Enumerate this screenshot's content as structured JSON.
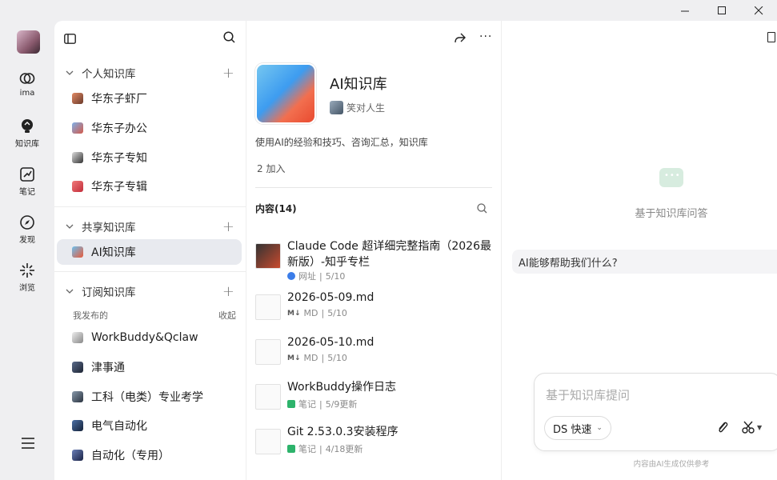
{
  "window": {
    "minimize": "—",
    "maximize": "☐",
    "close": "✕"
  },
  "rail": {
    "items": [
      {
        "label": "ima"
      },
      {
        "label": "知识库"
      },
      {
        "label": "笔记"
      },
      {
        "label": "发现"
      },
      {
        "label": "浏览"
      }
    ]
  },
  "sidebar": {
    "sections": {
      "personal": {
        "title": "个人知识库"
      },
      "shared": {
        "title": "共享知识库"
      },
      "subscribed": {
        "title": "订阅知识库"
      }
    },
    "personal_items": [
      "华东子虾厂",
      "华东子办公",
      "华东子专知",
      "华东子专辑"
    ],
    "shared_items": [
      "AI知识库"
    ],
    "subscribed_sub": {
      "label": "我发布的",
      "action": "收起"
    },
    "subscribed_items": [
      "WorkBuddy&Qclaw",
      "津事通",
      "工科（电类）专业考学",
      "电气自动化",
      "自动化（专用）"
    ]
  },
  "knowledge_base": {
    "title": "AI知识库",
    "author": "笑对人生",
    "description": "使用AI的经验和技巧、咨询汇总，知识库",
    "joined": "2 加入",
    "content_header": "内容(14)",
    "documents": [
      {
        "title": "Claude Code 超详细完整指南（2026最新版）-知乎专栏",
        "type": "网址",
        "date": "5/10"
      },
      {
        "title": "2026-05-09.md",
        "type": "MD",
        "date": "5/10"
      },
      {
        "title": "2026-05-10.md",
        "type": "MD",
        "date": "5/10"
      },
      {
        "title": "WorkBuddy操作日志",
        "type": "笔记",
        "date": "5/9更新"
      },
      {
        "title": "Git 2.53.0.3安装程序",
        "type": "笔记",
        "date": "4/18更新"
      }
    ]
  },
  "chat": {
    "empty_text": "基于知识库问答",
    "suggestion": "AI能够帮助我们什么?",
    "input_placeholder": "基于知识库提问",
    "model": "DS 快速",
    "footnote": "内容由AI生成仅供参考"
  },
  "colors": {
    "active_bg": "#e8eaef",
    "accent_green": "#2db36b",
    "web_blue": "#3b7de9"
  }
}
